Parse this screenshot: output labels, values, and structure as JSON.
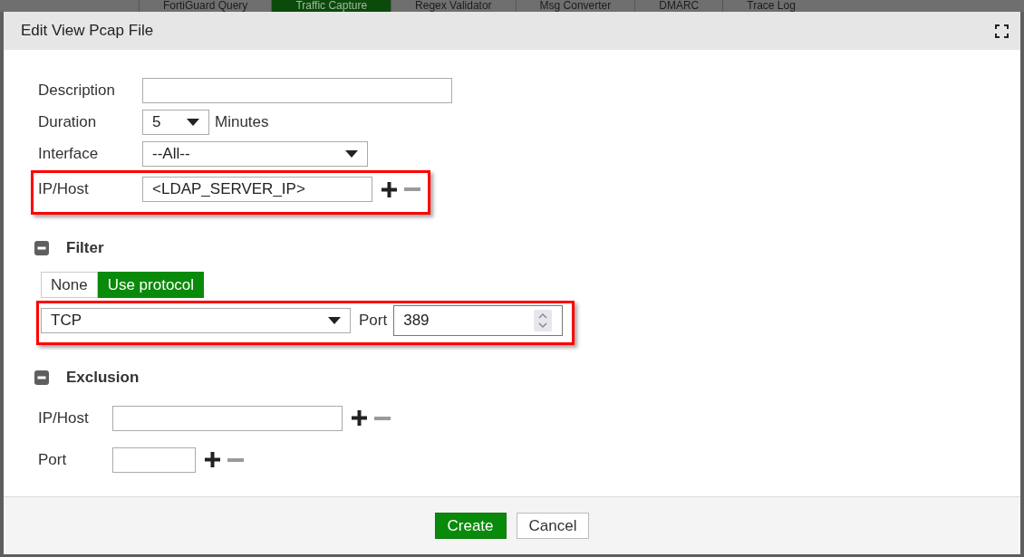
{
  "background_tabs": [
    {
      "label": "FortiGuard Query",
      "selected": false
    },
    {
      "label": "Traffic Capture",
      "selected": true
    },
    {
      "label": "Regex Validator",
      "selected": false
    },
    {
      "label": "Msg Converter",
      "selected": false
    },
    {
      "label": "DMARC",
      "selected": false
    },
    {
      "label": "Trace Log",
      "selected": false
    }
  ],
  "dialog": {
    "title": "Edit View Pcap File",
    "fields": [
      {
        "kind": "text",
        "label": "Description",
        "highlighted": false
      },
      {
        "kind": "select",
        "label": "Duration",
        "value": "5",
        "suffix": "Minutes",
        "highlighted": false
      },
      {
        "kind": "select",
        "label": "Interface",
        "value": "--All--",
        "highlighted": false
      },
      {
        "kind": "text",
        "label": "IP/Host",
        "value": "<LDAP_SERVER_IP>",
        "highlighted": true,
        "actions": [
          {
            "kind": "add",
            "disabled": false
          },
          {
            "kind": "remove",
            "disabled": true
          }
        ]
      }
    ],
    "filter": {
      "title": "Filter",
      "expanded": true,
      "options": [
        {
          "label": "None",
          "selected": false
        },
        {
          "label": "Use protocol",
          "selected": true
        }
      ],
      "highlighted": true,
      "protocol": {
        "value": "TCP"
      },
      "port": {
        "label": "Port",
        "value": "389"
      }
    },
    "exclusion": {
      "title": "Exclusion",
      "expanded": true,
      "fields": [
        {
          "kind": "text",
          "label": "IP/Host",
          "highlighted": false,
          "actions": [
            {
              "kind": "add",
              "disabled": false
            },
            {
              "kind": "remove",
              "disabled": true
            }
          ]
        },
        {
          "kind": "text",
          "label": "Port",
          "highlighted": false,
          "actions": [
            {
              "kind": "add",
              "disabled": false
            },
            {
              "kind": "remove",
              "disabled": true
            }
          ]
        }
      ]
    },
    "buttons": [
      {
        "label": "Create",
        "kind": "primary"
      },
      {
        "label": "Cancel",
        "kind": "secondary"
      }
    ]
  }
}
